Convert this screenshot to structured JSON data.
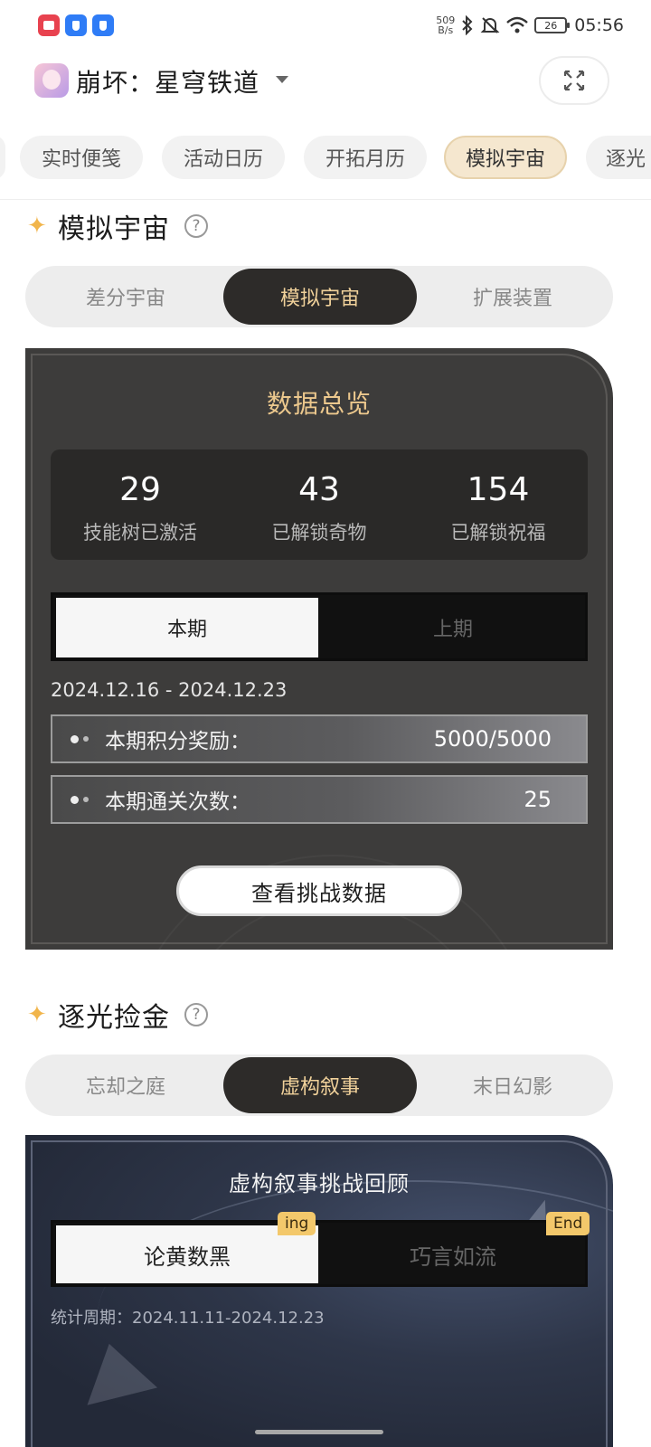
{
  "status_bar": {
    "net_speed_value": "509",
    "net_speed_unit": "B/s",
    "battery": "26",
    "time": "05:56"
  },
  "app": {
    "title": "崩坏：星穹铁道"
  },
  "top_tabs": [
    "实时便笺",
    "活动日历",
    "开拓月历",
    "模拟宇宙",
    "逐光"
  ],
  "section1": {
    "title": "模拟宇宙",
    "help": "?",
    "segments": [
      "差分宇宙",
      "模拟宇宙",
      "扩展装置"
    ],
    "card": {
      "title": "数据总览",
      "stats": [
        {
          "value": "29",
          "label": "技能树已激活"
        },
        {
          "value": "43",
          "label": "已解锁奇物"
        },
        {
          "value": "154",
          "label": "已解锁祝福"
        }
      ],
      "period_current": "本期",
      "period_previous": "上期",
      "date_range": "2024.12.16 - 2024.12.23",
      "reward_label": "本期积分奖励：",
      "reward_value": "5000/5000",
      "clears_label": "本期通关次数：",
      "clears_value": "25",
      "view_button": "查看挑战数据"
    }
  },
  "section2": {
    "title": "逐光捡金",
    "help": "?",
    "segments": [
      "忘却之庭",
      "虚构叙事",
      "末日幻影"
    ],
    "card": {
      "title": "虚构叙事挑战回顾",
      "stages": [
        {
          "label": "论黄数黑",
          "tag": "ing"
        },
        {
          "label": "巧言如流",
          "tag": "End"
        }
      ],
      "period_stat": "统计周期：2024.11.11-2024.12.23"
    }
  },
  "colors": {
    "accent_gold": "#ecc88d",
    "segment_active_bg": "#2d2b29",
    "tab_active_bg": "#f5e7cf",
    "card_bg": "#3d3c3b",
    "tag_bg": "#f3c86b"
  }
}
